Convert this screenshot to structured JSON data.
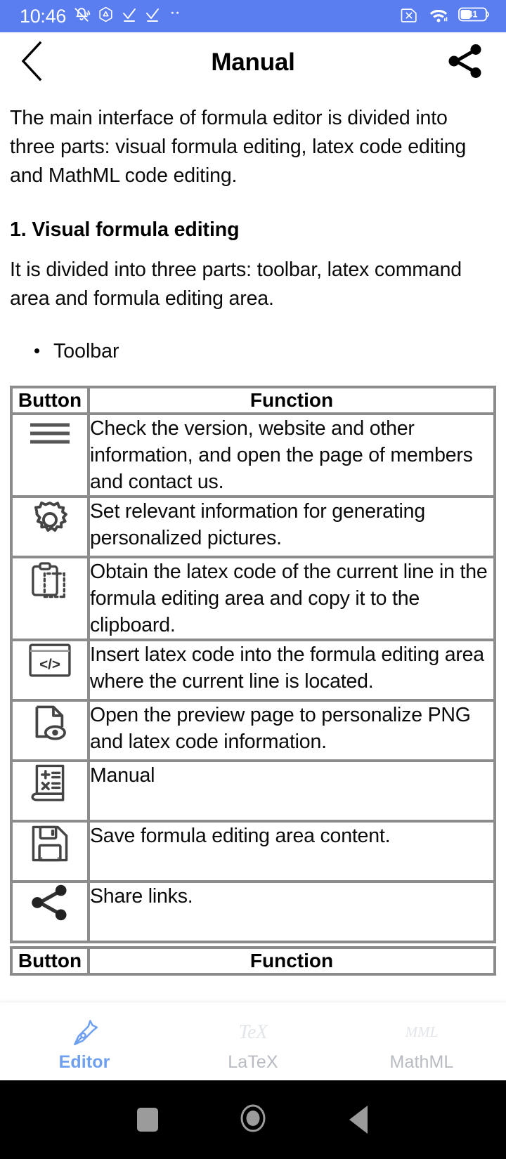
{
  "status_bar": {
    "time": "10:46",
    "left_icons": [
      "bell-mute-icon",
      "triangle-hexagon-icon",
      "checkmark-icon",
      "checkmark-icon",
      "ellipsis-icon"
    ],
    "right_icons": [
      "sim-card-x-icon",
      "wifi-icon",
      "battery-icon"
    ],
    "battery_level": "41",
    "bg_color": "#5a7ef0"
  },
  "title_bar": {
    "title": "Manual",
    "back_icon": "chevron-left-icon",
    "share_icon": "share-nodes-icon"
  },
  "content": {
    "intro_paragraph": "The main interface of formula editor is divided into three parts: visual formula editing, latex code editing and MathML code editing.",
    "section_heading": "1. Visual formula editing",
    "section_paragraph": "It is divided into three parts: toolbar, latex command area and formula editing area.",
    "bullets": [
      "Toolbar"
    ]
  },
  "table": {
    "headers": {
      "button": "Button",
      "function": "Function"
    },
    "rows": [
      {
        "icon": "hamburger-menu-icon",
        "function": "Check the version, website and other information, and open the page of members and contact us."
      },
      {
        "icon": "gear-icon",
        "function": "Set relevant information for generating personalized pictures."
      },
      {
        "icon": "clipboard-copy-icon",
        "function": "Obtain the latex code of the current line in the formula editing area and copy it to the clipboard."
      },
      {
        "icon": "code-tags-icon",
        "function": "Insert latex code into the formula editing area where the current line is located."
      },
      {
        "icon": "document-preview-eye-icon",
        "function": "Open the preview page to personalize PNG and latex code information."
      },
      {
        "icon": "math-book-icon",
        "function": "Manual"
      },
      {
        "icon": "floppy-save-icon",
        "function": "Save formula editing area content."
      },
      {
        "icon": "share-nodes-icon",
        "function": "Share links."
      }
    ],
    "second_table_headers": {
      "button": "Button",
      "function": "Function"
    },
    "border_color": "#8c8c8c"
  },
  "tab_bar": {
    "active_color": "#6fa0ef",
    "inactive_color": "#b8bcc2",
    "tabs": [
      {
        "label": "Editor",
        "icon": "pen-nib-icon",
        "logo": "",
        "active": true
      },
      {
        "label": "LaTeX",
        "icon": "tex-logo-icon",
        "logo": "TeX",
        "active": false
      },
      {
        "label": "MathML",
        "icon": "mml-logo-icon",
        "logo": "MML",
        "active": false
      }
    ]
  },
  "nav_bar": {
    "buttons": [
      {
        "name": "recents-button",
        "icon": "square-icon"
      },
      {
        "name": "home-button",
        "icon": "circle-icon"
      },
      {
        "name": "back-button",
        "icon": "triangle-left-icon"
      }
    ]
  }
}
